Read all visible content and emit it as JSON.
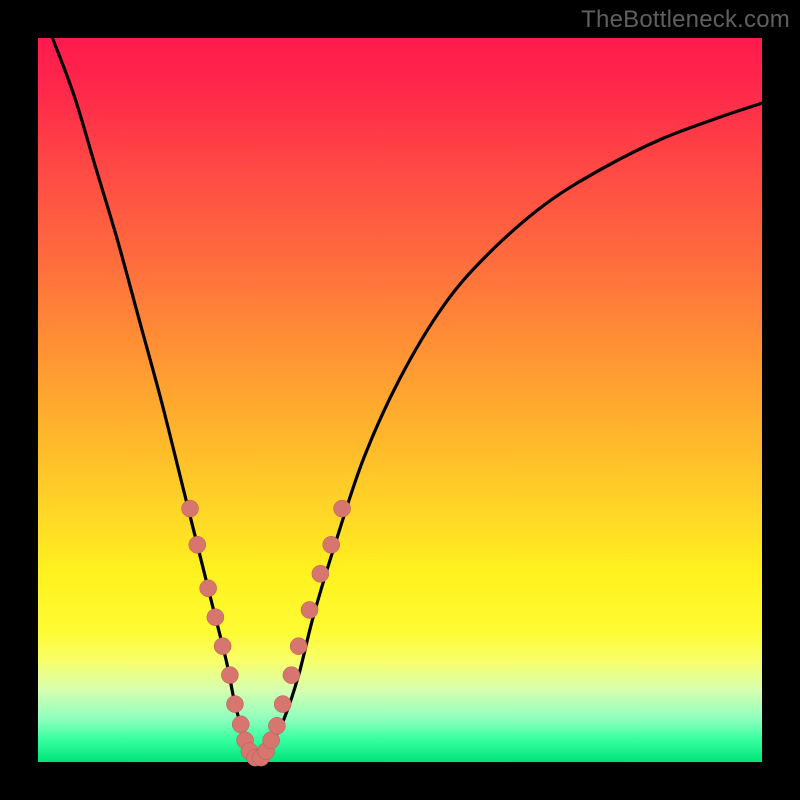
{
  "watermark": "TheBottleneck.com",
  "colors": {
    "background": "#000000",
    "gradient_top": "#ff1a4d",
    "gradient_bottom": "#00e37a",
    "curve": "#000000",
    "dots": "#d6766e"
  },
  "chart_data": {
    "type": "line",
    "title": "",
    "xlabel": "",
    "ylabel": "",
    "xlim": [
      0,
      100
    ],
    "ylim": [
      0,
      100
    ],
    "series": [
      {
        "name": "bottleneck-curve",
        "x": [
          2,
          5,
          8,
          11,
          14,
          17,
          20,
          22,
          24,
          26,
          27,
          28,
          29,
          30,
          31,
          32,
          34,
          36,
          38,
          41,
          45,
          50,
          56,
          62,
          70,
          78,
          86,
          94,
          100
        ],
        "y": [
          100,
          92,
          82,
          72,
          61,
          50,
          38,
          30,
          22,
          14,
          9,
          5,
          2,
          0.5,
          0.5,
          2,
          6,
          12,
          20,
          30,
          42,
          53,
          63,
          70,
          77,
          82,
          86,
          89,
          91
        ]
      }
    ],
    "markers": {
      "name": "highlight-dots",
      "points": [
        {
          "x": 21.0,
          "y": 35
        },
        {
          "x": 22.0,
          "y": 30
        },
        {
          "x": 23.5,
          "y": 24
        },
        {
          "x": 24.5,
          "y": 20
        },
        {
          "x": 25.5,
          "y": 16
        },
        {
          "x": 26.5,
          "y": 12
        },
        {
          "x": 27.2,
          "y": 8
        },
        {
          "x": 28.0,
          "y": 5.2
        },
        {
          "x": 28.6,
          "y": 3
        },
        {
          "x": 29.2,
          "y": 1.5
        },
        {
          "x": 30.0,
          "y": 0.6
        },
        {
          "x": 30.8,
          "y": 0.6
        },
        {
          "x": 31.5,
          "y": 1.5
        },
        {
          "x": 32.2,
          "y": 3
        },
        {
          "x": 33.0,
          "y": 5
        },
        {
          "x": 33.8,
          "y": 8
        },
        {
          "x": 35.0,
          "y": 12
        },
        {
          "x": 36.0,
          "y": 16
        },
        {
          "x": 37.5,
          "y": 21
        },
        {
          "x": 39.0,
          "y": 26
        },
        {
          "x": 40.5,
          "y": 30
        },
        {
          "x": 42.0,
          "y": 35
        }
      ]
    }
  }
}
